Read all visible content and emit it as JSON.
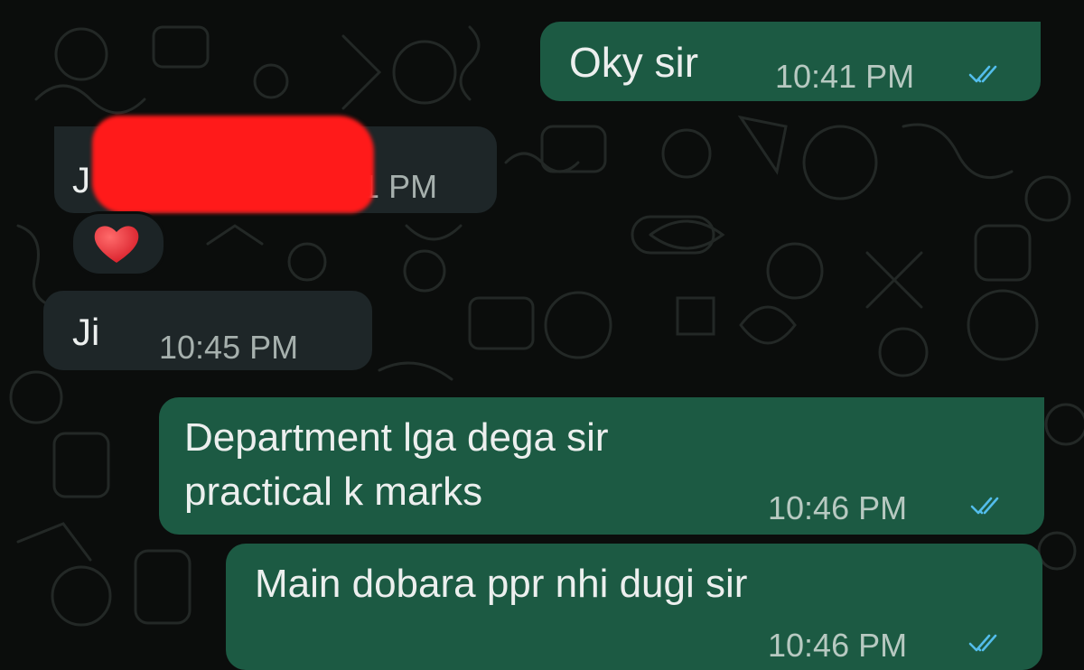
{
  "chat": {
    "messages": [
      {
        "direction": "outgoing",
        "text": "Oky sir",
        "time": "10:41 PM",
        "status": "read"
      },
      {
        "direction": "incoming",
        "text_visible": "J",
        "redacted": true,
        "time_visible": "0:41 PM",
        "reaction": "❤️"
      },
      {
        "direction": "incoming",
        "text": "Ji",
        "time": "10:45 PM"
      },
      {
        "direction": "outgoing",
        "lines": [
          "Department lga dega sir",
          "practical k marks"
        ],
        "time": "10:46 PM",
        "status": "read"
      },
      {
        "direction": "outgoing",
        "text": "Main dobara ppr nhi dugi sir",
        "time": "10:46 PM",
        "status": "read"
      }
    ]
  },
  "colors": {
    "background": "#0b0d0c",
    "outgoing_bubble": "#1c5a43",
    "incoming_bubble": "#1e2628",
    "read_ticks": "#53bdeb",
    "redaction": "#ff1a1a"
  },
  "icons": {
    "read_receipt": "double-check-icon",
    "reaction": "heart-icon"
  }
}
